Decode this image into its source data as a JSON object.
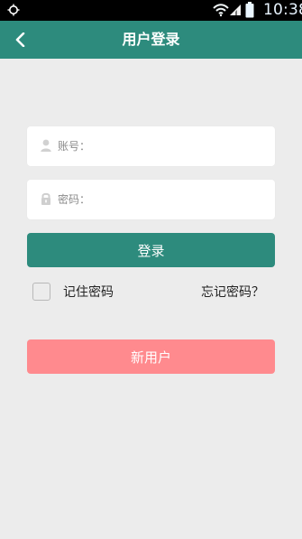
{
  "status_bar": {
    "time": "10:38",
    "icons": [
      "status-icon",
      "wifi-icon",
      "signal-icon",
      "battery-icon"
    ]
  },
  "toolbar": {
    "title": "用户登录",
    "back_icon": "back-icon",
    "color": "#2d8b7d"
  },
  "form": {
    "account": {
      "label": "账号：",
      "icon": "user-icon",
      "value": ""
    },
    "password": {
      "label": "密码：",
      "icon": "lock-icon",
      "value": ""
    },
    "login_button_label": "登录",
    "remember_label": "记住密码",
    "remember_checked": false,
    "forgot_label": "忘记密码？",
    "register_button_label": "新用户"
  },
  "colors": {
    "primary": "#2d8b7d",
    "register": "#ff8a8e",
    "background": "#ececec"
  }
}
